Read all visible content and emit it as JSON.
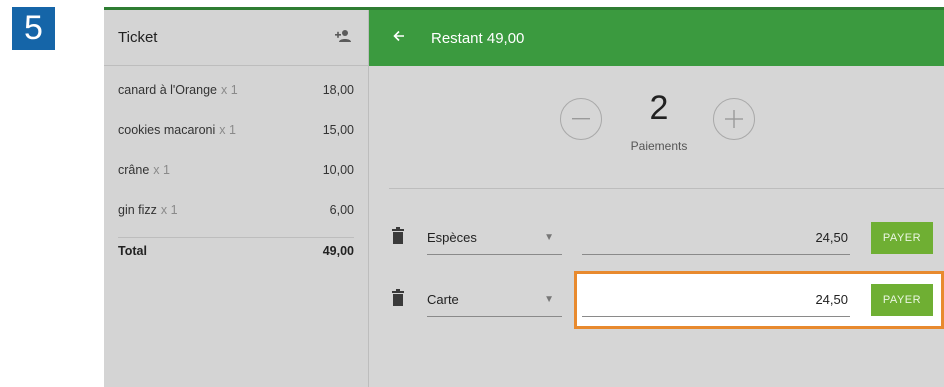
{
  "step_number": "5",
  "ticket": {
    "title": "Ticket",
    "add_person_icon": "person-add-icon",
    "lines": [
      {
        "name": "canard à l'Orange",
        "qty": "x 1",
        "price": "18,00"
      },
      {
        "name": "cookies macaroni",
        "qty": "x 1",
        "price": "15,00"
      },
      {
        "name": "crâne",
        "qty": "x 1",
        "price": "10,00"
      },
      {
        "name": "gin fizz",
        "qty": "x 1",
        "price": "6,00"
      }
    ],
    "total_label": "Total",
    "total_value": "49,00"
  },
  "payment": {
    "header_title": "Restant 49,00",
    "count": "2",
    "count_label": "Paiements",
    "rows": [
      {
        "method": "Espèces",
        "amount": "24,50",
        "button": "PAYER"
      },
      {
        "method": "Carte",
        "amount": "24,50",
        "button": "PAYER"
      }
    ]
  },
  "colors": {
    "header_green": "#3b9a3f",
    "pay_button_green": "#6faf33",
    "highlight_orange": "#e88a2e",
    "step_badge_blue": "#1565a8"
  }
}
